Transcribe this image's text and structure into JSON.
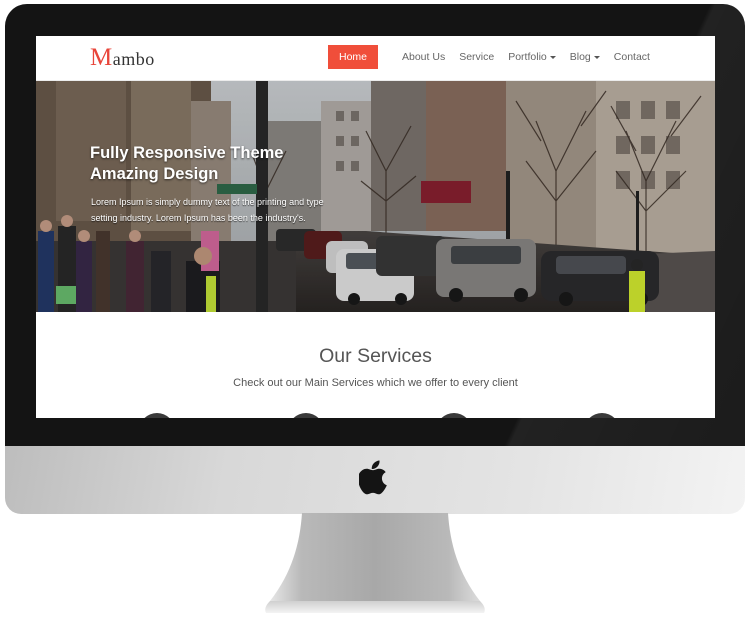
{
  "site": {
    "logo_initial": "M",
    "logo_rest": "ambo"
  },
  "nav": {
    "items": [
      {
        "label": "Home",
        "active": true,
        "dropdown": false
      },
      {
        "label": "About Us",
        "active": false,
        "dropdown": false
      },
      {
        "label": "Service",
        "active": false,
        "dropdown": false
      },
      {
        "label": "Portfolio",
        "active": false,
        "dropdown": true
      },
      {
        "label": "Blog",
        "active": false,
        "dropdown": true
      },
      {
        "label": "Contact",
        "active": false,
        "dropdown": false
      }
    ]
  },
  "hero": {
    "title_line1": "Fully Responsive Theme",
    "title_line2": "Amazing Design",
    "text": "Lorem Ipsum is simply dummy text of the printing and type setting industry. Lorem Ipsum has been the industry's."
  },
  "services": {
    "title": "Our Services",
    "subtitle": "Check out our Main Services which we offer to every client"
  },
  "colors": {
    "accent": "#f04e3a",
    "logo_accent": "#e8453a",
    "bezel": "#141414",
    "chin": "#d8d8d8"
  },
  "icons": [
    "apple-logo-icon",
    "caret-down-icon"
  ]
}
